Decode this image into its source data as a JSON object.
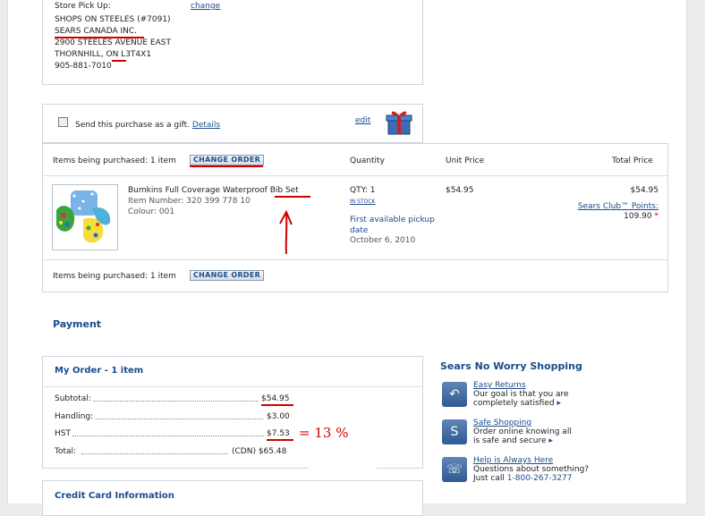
{
  "store": {
    "heading": "Store Pick Up:",
    "change": "change",
    "lines": [
      "SHOPS ON STEELES (#7091)",
      "SEARS CANADA INC.",
      "2900 STEELES AVENUE EAST",
      "THORNHILL, ON L3T4X1",
      "905-881-7010"
    ]
  },
  "gift": {
    "label": "Send this purchase as a gift.",
    "details": "Details",
    "edit": "edit"
  },
  "items": {
    "purchased_label": "Items being purchased: 1 item",
    "change_order": "CHANGE ORDER",
    "columns": [
      "Quantity",
      "Unit Price",
      "Total Price"
    ],
    "product": {
      "name": "Bumkins Full Coverage Waterproof Bib Set",
      "item_number": "Item Number:  320 399 778 10",
      "colour": "Colour: 001",
      "qty": "QTY:  1",
      "stock": "IN STOCK",
      "pickup_label": "First available pickup date",
      "pickup_date": "October 6, 2010",
      "unit_price": "$54.95",
      "total_price": "$54.95",
      "points_label": "Sears Club™ Points:",
      "points_value": "109.90"
    }
  },
  "payment": {
    "heading": "Payment"
  },
  "order": {
    "title": "My Order - 1 item",
    "rows": [
      {
        "label": "Subtotal:",
        "value": "$54.95"
      },
      {
        "label": "Handling:",
        "value": "$3.00"
      },
      {
        "label": "HST",
        "value": "$7.53"
      },
      {
        "label": "Total:",
        "value": "(CDN)  $65.48"
      }
    ],
    "annotation": "= 13 %"
  },
  "credit": {
    "title": "Credit Card Information"
  },
  "noworry": {
    "title": "Sears No Worry Shopping",
    "features": [
      {
        "icon": "return-arrow-icon",
        "title": "Easy Returns",
        "desc1": "Our goal is that you are",
        "desc2": "completely satisfied"
      },
      {
        "icon": "shield-s-icon",
        "title": "Safe Shopping",
        "desc1": "Order online knowing all",
        "desc2": "is safe and secure"
      },
      {
        "icon": "phone-icon",
        "title": "Help is Always Here",
        "desc1": "Questions about something?",
        "desc2": "Just call",
        "phone": "1-800-267-3277"
      }
    ]
  },
  "colors": {
    "accent": "#1a4b8c",
    "annotation": "#d00000"
  }
}
